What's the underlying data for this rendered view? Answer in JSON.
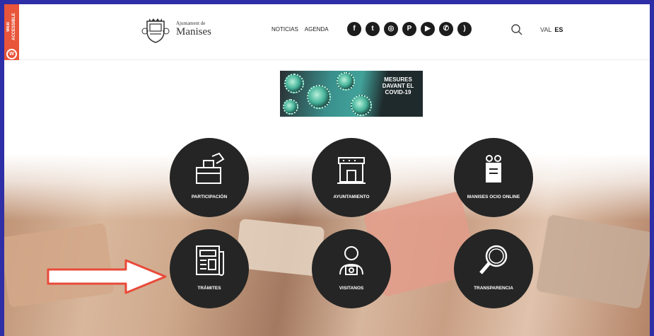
{
  "accessibility": {
    "tab_label": "WEB ACCESSIBLE",
    "logo_letter": "W"
  },
  "brand": {
    "small": "Ajuntament de",
    "name": "Manises"
  },
  "menu": [
    {
      "label": "NOTICIAS"
    },
    {
      "label": "AGENDA"
    }
  ],
  "socials": [
    {
      "name": "facebook-icon",
      "glyph": "f"
    },
    {
      "name": "twitter-icon",
      "glyph": "t"
    },
    {
      "name": "instagram-icon",
      "glyph": "◎"
    },
    {
      "name": "pinterest-icon",
      "glyph": "P"
    },
    {
      "name": "youtube-icon",
      "glyph": "▶"
    },
    {
      "name": "whatsapp-icon",
      "glyph": "✆"
    },
    {
      "name": "rss-icon",
      "glyph": ")"
    }
  ],
  "languages": {
    "val": "VAL",
    "es": "ES",
    "active": "ES"
  },
  "banner": {
    "text": "MESURES\nDAVANT EL\nCOVID-19"
  },
  "tiles": [
    {
      "label": "PARTICIPACIÓN",
      "icon": "ballot-box-icon"
    },
    {
      "label": "AYUNTAMIENTO",
      "icon": "town-hall-icon"
    },
    {
      "label": "MANISES OCIO ONLINE",
      "icon": "leisure-online-icon"
    },
    {
      "label": "TRÁMITES",
      "icon": "newspaper-icon"
    },
    {
      "label": "VISITANOS",
      "icon": "visitor-camera-icon"
    },
    {
      "label": "TRANSPARENCIA",
      "icon": "magnifier-icon"
    }
  ],
  "colors": {
    "accent": "#e8553a",
    "tile": "#252525",
    "frame": "#2e2ea6",
    "arrow": "#e84a3a"
  }
}
